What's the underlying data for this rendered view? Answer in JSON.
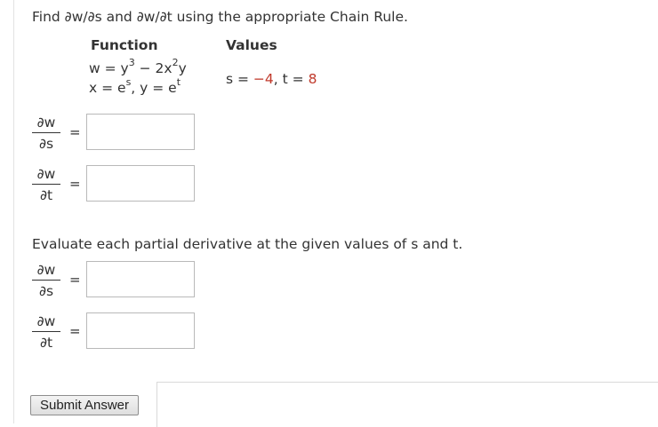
{
  "question": {
    "text": "Find ∂w/∂s and ∂w/∂t using the appropriate Chain Rule."
  },
  "table": {
    "function_header": "Function",
    "values_header": "Values",
    "w_lhs": "w = y",
    "w_exp1": "3",
    "w_mid": " − 2x",
    "w_exp2": "2",
    "w_tail": "y",
    "x_lhs": "x = e",
    "x_exp": "s",
    "y_lhs": ",  y = e",
    "y_exp": "t",
    "s_label": "s = ",
    "s_value": "−4",
    "t_label": ",  t = ",
    "t_value": "8"
  },
  "part1": {
    "dws": {
      "num": "∂w",
      "den": "∂s",
      "equals": "=",
      "value": ""
    },
    "dwt": {
      "num": "∂w",
      "den": "∂t",
      "equals": "=",
      "value": ""
    }
  },
  "part2": {
    "instruction": "Evaluate each partial derivative at the given values of s and t.",
    "dws": {
      "num": "∂w",
      "den": "∂s",
      "equals": "=",
      "value": ""
    },
    "dwt": {
      "num": "∂w",
      "den": "∂t",
      "equals": "=",
      "value": ""
    }
  },
  "submit": {
    "label": "Submit Answer"
  }
}
